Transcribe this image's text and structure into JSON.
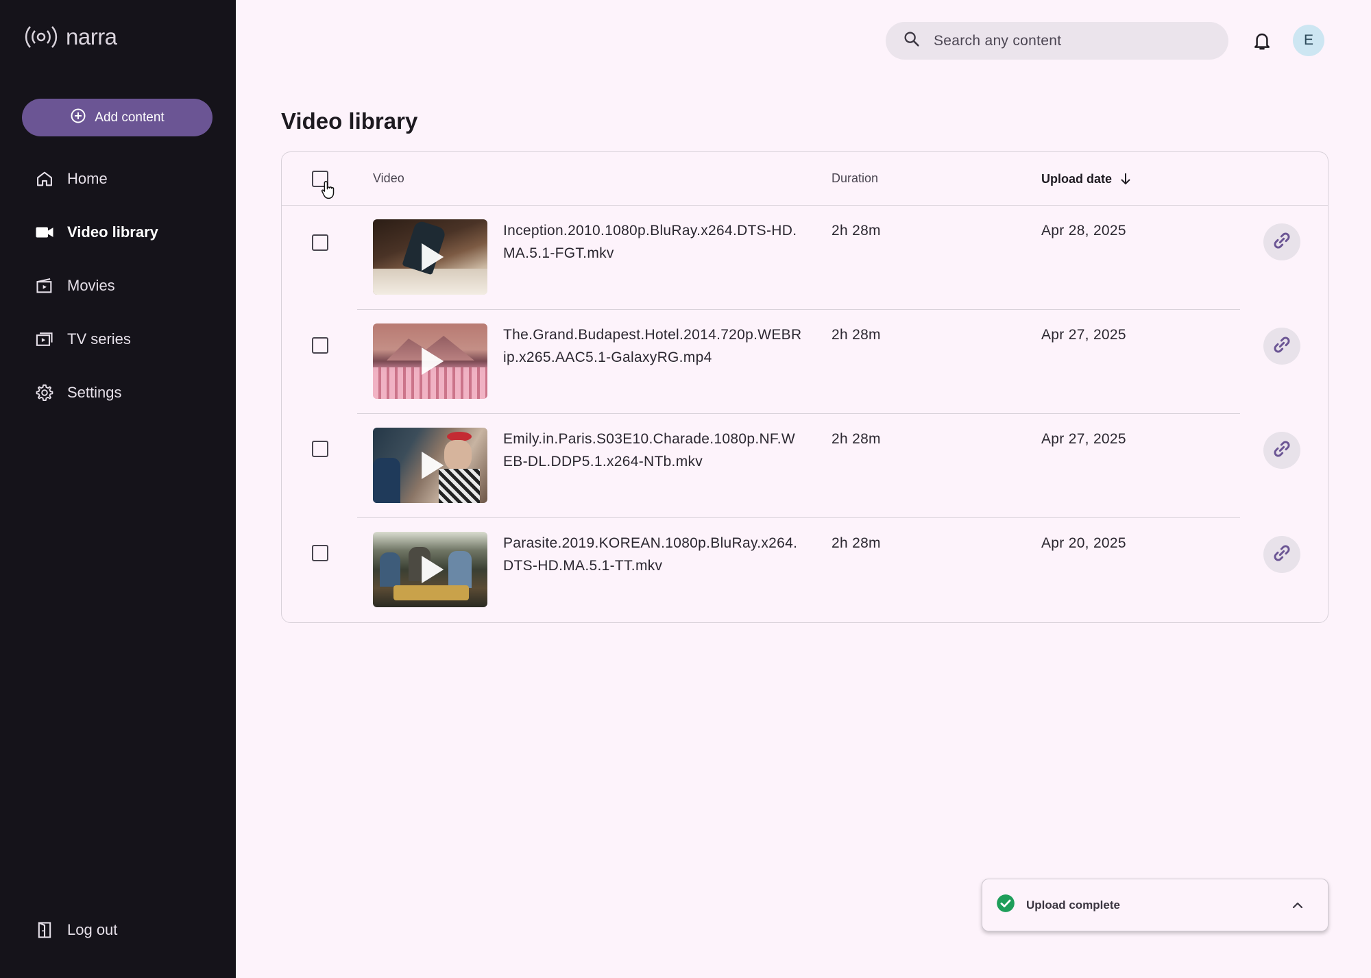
{
  "brand": {
    "name": "narra",
    "icon": "broadcast-icon"
  },
  "sidebar": {
    "add_button": {
      "label": "Add content",
      "icon": "add-circle-icon"
    },
    "items": [
      {
        "label": "Home",
        "icon": "home-icon",
        "active": false
      },
      {
        "label": "Video library",
        "icon": "videocam-icon",
        "active": true
      },
      {
        "label": "Movies",
        "icon": "movie-icon",
        "active": false
      },
      {
        "label": "TV series",
        "icon": "tv-icon",
        "active": false
      },
      {
        "label": "Settings",
        "icon": "gear-icon",
        "active": false
      }
    ],
    "logout": {
      "label": "Log out",
      "icon": "logout-icon"
    }
  },
  "header": {
    "search_placeholder": "Search any content",
    "avatar_initial": "E"
  },
  "page": {
    "title": "Video library"
  },
  "table": {
    "columns": {
      "video": "Video",
      "duration": "Duration",
      "upload_date": "Upload date"
    },
    "sort": {
      "column": "upload_date",
      "direction": "descending"
    },
    "rows": [
      {
        "file": "Inception.2010.1080p.BluRay.x264.DTS-HD.MA.5.1-FGT.mkv",
        "duration": "2h 28m",
        "date": "Apr 28, 2025"
      },
      {
        "file": "The.Grand.Budapest.Hotel.2014.720p.WEBRip.x265.AAC5.1-GalaxyRG.mp4",
        "duration": "2h 28m",
        "date": "Apr 27, 2025"
      },
      {
        "file": "Emily.in.Paris.S03E10.Charade.1080p.NF.WEB-DL.DDP5.1.x264-NTb.mkv",
        "duration": "2h 28m",
        "date": "Apr 27, 2025"
      },
      {
        "file": "Parasite.2019.KOREAN.1080p.BluRay.x264.DTS-HD.MA.5.1-TT.mkv",
        "duration": "2h 28m",
        "date": "Apr 20, 2025"
      }
    ]
  },
  "toast": {
    "text": "Upload complete",
    "status_color": "#1e9e5a"
  },
  "colors": {
    "accent": "#6b5594",
    "sidebar_bg": "#15131a",
    "page_bg": "#fdf3fb"
  }
}
